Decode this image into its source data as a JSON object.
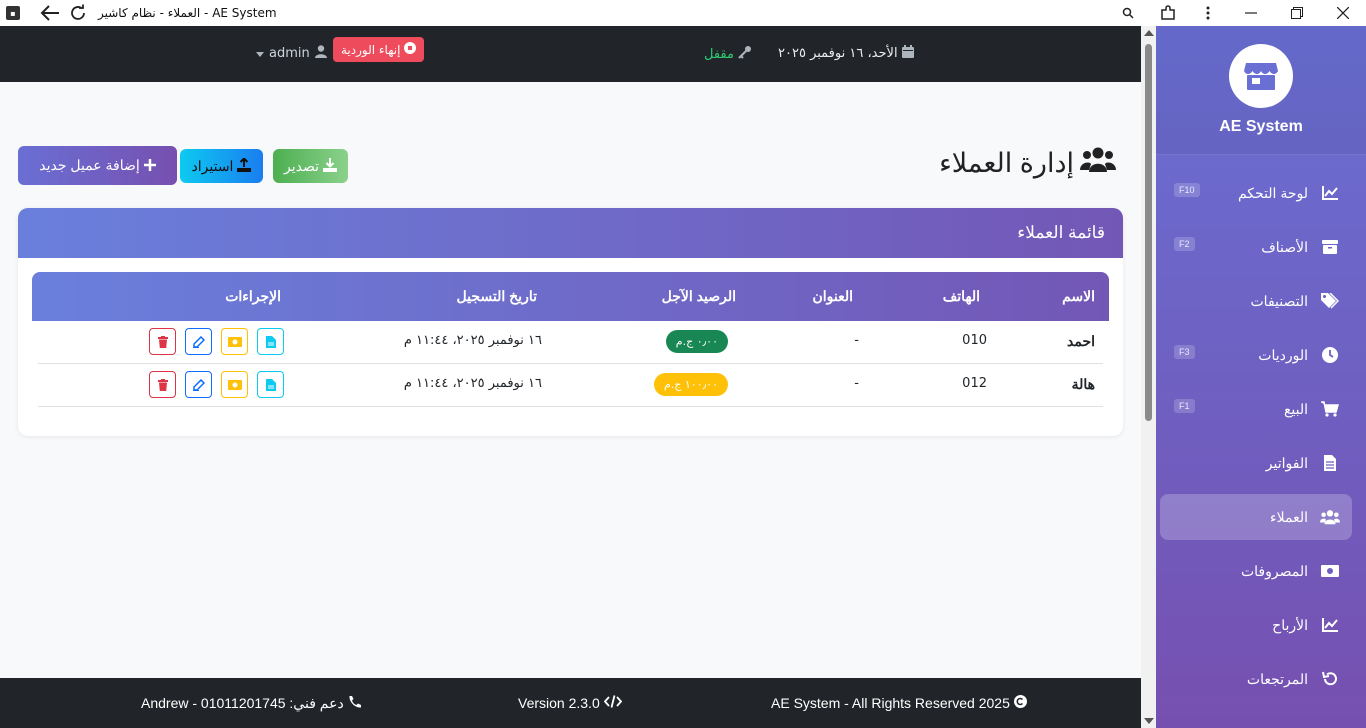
{
  "window": {
    "title": "العملاء - نظام كاشير - AE System"
  },
  "brand": {
    "name": "AE System"
  },
  "sidebar": {
    "items": [
      {
        "label": "لوحة التحكم",
        "key": "F10",
        "icon": "chart-line-icon"
      },
      {
        "label": "الأصناف",
        "key": "F2",
        "icon": "box-icon"
      },
      {
        "label": "التصنيفات",
        "key": "",
        "icon": "tags-icon"
      },
      {
        "label": "الورديات",
        "key": "F3",
        "icon": "clock-icon"
      },
      {
        "label": "البيع",
        "key": "F1",
        "icon": "cart-icon"
      },
      {
        "label": "الفواتير",
        "key": "",
        "icon": "invoice-icon"
      },
      {
        "label": "العملاء",
        "key": "",
        "icon": "users-icon",
        "active": true
      },
      {
        "label": "المصروفات",
        "key": "",
        "icon": "money-icon"
      },
      {
        "label": "الأرباح",
        "key": "",
        "icon": "chart-line-icon"
      },
      {
        "label": "المرتجعات",
        "key": "",
        "icon": "undo-icon"
      }
    ]
  },
  "topbar": {
    "date": "الأحد، ١٦ نوفمبر ٢٠٢٥",
    "status": "مقفل",
    "end_shift": "إنهاء الوردية",
    "user": "admin"
  },
  "page": {
    "title": "إدارة العملاء",
    "export_label": "تصدير",
    "import_label": "استيراد",
    "add_label": "إضافة عميل جديد",
    "card_title": "قائمة العملاء"
  },
  "table": {
    "headers": {
      "name": "الاسم",
      "phone": "الهاتف",
      "address": "العنوان",
      "balance": "الرصيد الآجل",
      "date": "تاريخ التسجيل",
      "actions": "الإجراءات"
    },
    "rows": [
      {
        "name": "احمد",
        "phone": "010",
        "address": "-",
        "balance": "٠٫٠٠ ج.م",
        "date": "١٦ نوفمبر ٢٠٢٥، ١١:٤٤ م",
        "balance_status": "green"
      },
      {
        "name": "هالة",
        "phone": "012",
        "address": "-",
        "balance": "١٠٠٫٠٠ ج.م",
        "date": "١٦ نوفمبر ٢٠٢٥، ١١:٤٤ م",
        "balance_status": "yellow"
      }
    ]
  },
  "footer": {
    "rights": "AE System - All Rights Reserved 2025",
    "version": "Version 2.3.0",
    "support": "دعم فني: 01011201745 - Andrew"
  },
  "colors": {
    "accent_start": "#6a7fdc",
    "accent_end": "#7357b6",
    "danger": "#dc3545",
    "success": "#198754",
    "warning": "#ffc107"
  }
}
